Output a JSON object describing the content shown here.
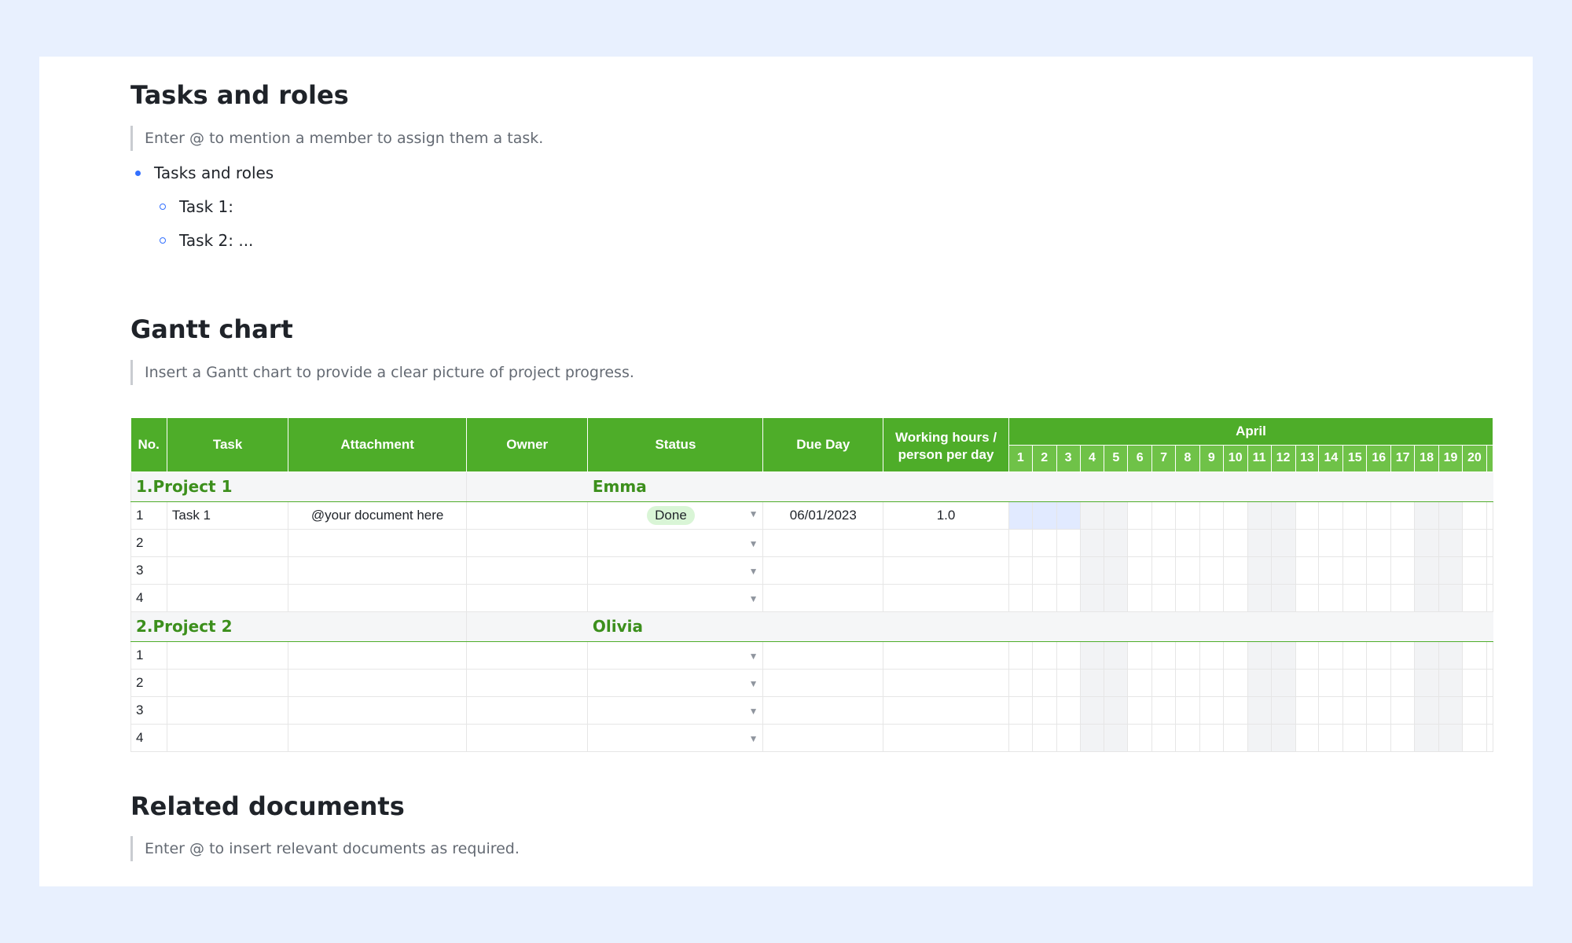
{
  "sections": {
    "tasks": {
      "title": "Tasks and roles",
      "hint": "Enter @ to mention a member to assign them a task.",
      "bullet": "Tasks and roles",
      "sub_items": [
        "Task 1:",
        "Task 2: ..."
      ]
    },
    "gantt": {
      "title": "Gantt chart",
      "hint": "Insert a Gantt chart to provide a clear picture of project progress."
    },
    "related": {
      "title": "Related documents",
      "hint": "Enter @ to insert relevant documents as required."
    }
  },
  "table": {
    "headers": {
      "no": "No.",
      "task": "Task",
      "attachment": "Attachment",
      "owner": "Owner",
      "status": "Status",
      "due": "Due Day",
      "hours_line1": "Working hours /",
      "hours_line2": "person per day",
      "month": "April"
    },
    "days": [
      "1",
      "2",
      "3",
      "4",
      "5",
      "6",
      "7",
      "8",
      "9",
      "10",
      "11",
      "12",
      "13",
      "14",
      "15",
      "16",
      "17",
      "18",
      "19",
      "20"
    ],
    "weekend_day_indices": [
      3,
      4,
      10,
      11,
      17,
      18
    ],
    "highlight_day_indices": [
      0,
      1,
      2
    ],
    "projects": [
      {
        "label": "1.Project 1",
        "owner": "Emma",
        "rows": [
          {
            "no": "1",
            "task": "Task 1",
            "attachment": "@your document here",
            "status": "Done",
            "due": "06/01/2023",
            "hours": "1.0"
          },
          {
            "no": "2",
            "task": "",
            "attachment": "",
            "status": "",
            "due": "",
            "hours": ""
          },
          {
            "no": "3",
            "task": "",
            "attachment": "",
            "status": "",
            "due": "",
            "hours": ""
          },
          {
            "no": "4",
            "task": "",
            "attachment": "",
            "status": "",
            "due": "",
            "hours": ""
          }
        ]
      },
      {
        "label": "2.Project 2",
        "owner": "Olivia",
        "rows": [
          {
            "no": "1",
            "task": "",
            "attachment": "",
            "status": "",
            "due": "",
            "hours": ""
          },
          {
            "no": "2",
            "task": "",
            "attachment": "",
            "status": "",
            "due": "",
            "hours": ""
          },
          {
            "no": "3",
            "task": "",
            "attachment": "",
            "status": "",
            "due": "",
            "hours": ""
          },
          {
            "no": "4",
            "task": "",
            "attachment": "",
            "status": "",
            "due": "",
            "hours": ""
          }
        ]
      }
    ]
  },
  "colors": {
    "header_green": "#4ead29",
    "day_green": "#6fc248",
    "project_text": "#3c8f1c",
    "status_done_bg": "#d9f5d6",
    "bullet_blue": "#3370ff"
  }
}
